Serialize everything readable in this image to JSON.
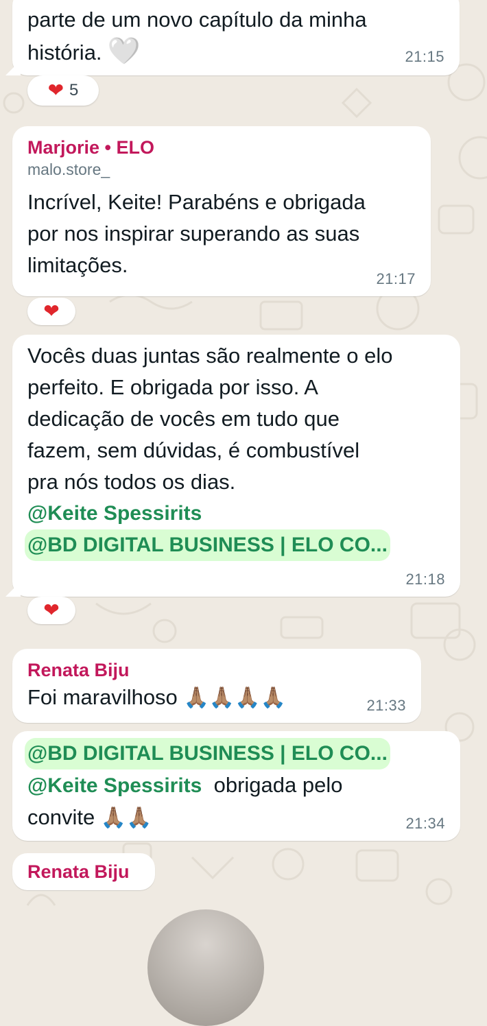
{
  "messages": [
    {
      "text": "parte de um novo capítulo da minha\nhistória.",
      "emoji": "🤍",
      "time": "21:15",
      "reaction": {
        "emoji": "❤",
        "count": "5"
      }
    },
    {
      "sender": "Marjorie • ELO",
      "handle": "malo.store_",
      "text": "Incrível, Keite! Parabéns e obrigada\npor nos inspirar superando as suas\nlimitações.",
      "time": "21:17",
      "reaction": {
        "emoji": "❤"
      }
    },
    {
      "text": "Vocês duas juntas são realmente o elo\nperfeito. E obrigada por isso. A\ndedicação de vocês em tudo que\nfazem, sem dúvidas, é combustível\npra nós todos os dias.",
      "mention1": "@Keite Spessirits",
      "mention2": "@BD DIGITAL BUSINESS | ELO CO...",
      "time": "21:18",
      "reaction": {
        "emoji": "❤"
      }
    },
    {
      "sender": "Renata Biju",
      "text": "Foi maravilhoso",
      "emoji": "🙏🏽🙏🏽🙏🏽🙏🏽",
      "time": "21:33"
    },
    {
      "mention1": "@BD DIGITAL BUSINESS | ELO CO...",
      "mention2": "@Keite Spessirits",
      "text_after": "obrigada pelo",
      "text2": "convite",
      "emoji": "🙏🏽🙏🏽",
      "time": "21:34"
    },
    {
      "sender": "Renata Biju"
    }
  ],
  "colors": {
    "background": "#efeae2",
    "bubble": "#ffffff",
    "sender": "#c2185b",
    "mention": "#1f8d55",
    "mention_highlight": "#d9fdd3",
    "time": "#667781"
  }
}
